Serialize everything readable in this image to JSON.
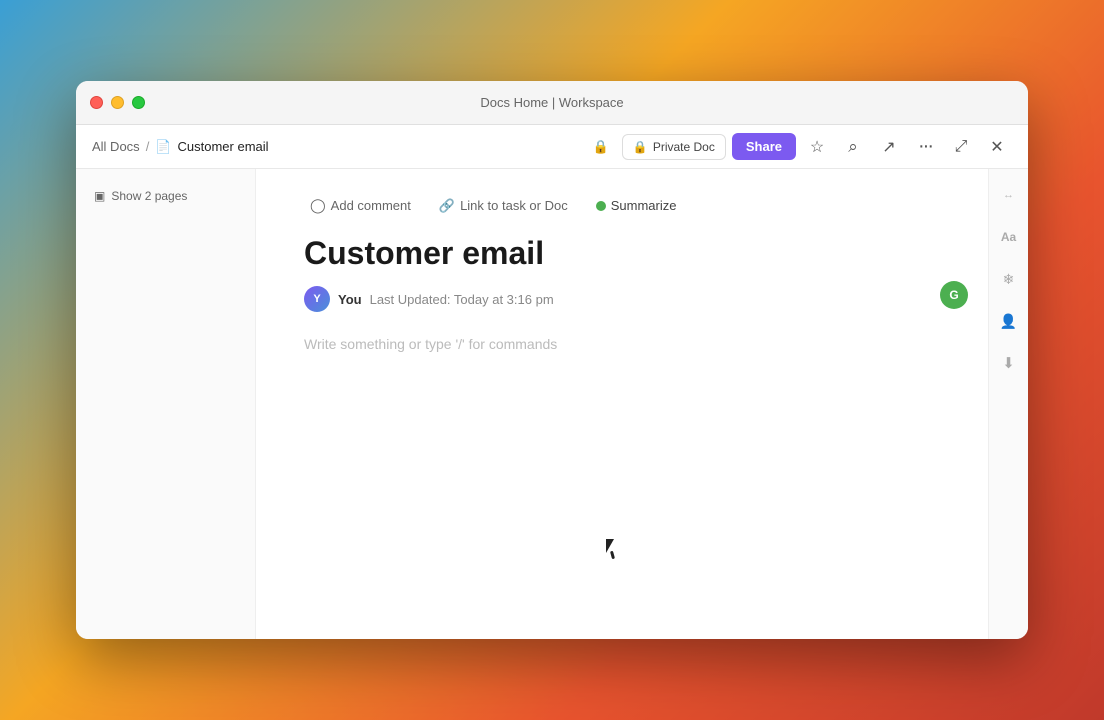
{
  "window": {
    "title": "Docs Home | Workspace",
    "traffic_lights": {
      "close": "close",
      "minimize": "minimize",
      "maximize": "maximize"
    }
  },
  "toolbar": {
    "breadcrumb": {
      "all_docs": "All Docs",
      "separator": "/",
      "doc_icon": "📄",
      "current": "Customer email"
    },
    "private_doc_label": "Private Doc",
    "share_label": "Share",
    "lock_icon": "🔒",
    "star_icon": "☆",
    "search_icon": "⌕",
    "export_icon": "↗",
    "more_icon": "···",
    "minimize_icon": "⤢",
    "close_icon": "✕"
  },
  "left_sidebar": {
    "show_pages_label": "Show 2 pages",
    "pages_icon": "▣"
  },
  "doc_toolbar": {
    "add_comment_icon": "◯",
    "add_comment_label": "Add comment",
    "link_icon": "⛓",
    "link_label": "Link to task or Doc",
    "summarize_label": "Summarize"
  },
  "document": {
    "title": "Customer email",
    "author": "You",
    "last_updated": "Last Updated: Today at 3:16 pm",
    "placeholder": "Write something or type '/' for commands"
  },
  "right_sidebar": {
    "font_icon": "Aa",
    "snowflake_icon": "❄",
    "person_icon": "👤",
    "download_icon": "⬇"
  }
}
